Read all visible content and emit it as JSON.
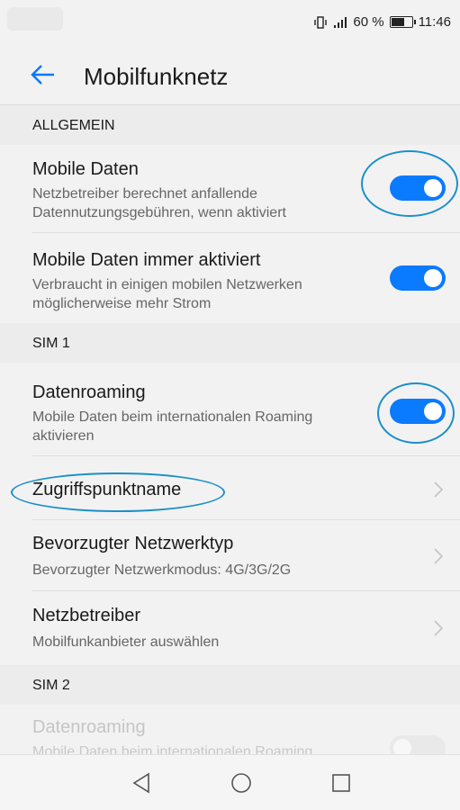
{
  "status": {
    "signal_text": "60 %",
    "time": "11:46"
  },
  "header": {
    "title": "Mobilfunknetz"
  },
  "sections": {
    "general": "ALLGEMEIN",
    "sim1": "SIM 1",
    "sim2": "SIM 2"
  },
  "items": {
    "mobile_data": {
      "title": "Mobile Daten",
      "subtitle": "Netzbetreiber berechnet anfallende Datennutzungsgebühren, wenn aktiviert",
      "enabled": true
    },
    "mobile_data_always": {
      "title": "Mobile Daten immer aktiviert",
      "subtitle": "Verbraucht in einigen mobilen Netzwerken möglicherweise mehr Strom",
      "enabled": true
    },
    "data_roaming_sim1": {
      "title": "Datenroaming",
      "subtitle": "Mobile Daten beim internationalen Roaming aktivieren",
      "enabled": true
    },
    "apn": {
      "title": "Zugriffspunktname"
    },
    "preferred_network": {
      "title": "Bevorzugter Netzwerktyp",
      "subtitle": "Bevorzugter Netzwerkmodus: 4G/3G/2G"
    },
    "operator": {
      "title": "Netzbetreiber",
      "subtitle": "Mobilfunkanbieter auswählen"
    },
    "data_roaming_sim2": {
      "title": "Datenroaming",
      "subtitle": "Mobile Daten beim internationalen Roaming aktivieren",
      "enabled": false
    }
  },
  "icons": {
    "back": "arrow-left-icon",
    "chevron": "chevron-right-icon",
    "nav_back": "triangle-back-icon",
    "nav_home": "circle-home-icon",
    "nav_recents": "square-recents-icon"
  },
  "colors": {
    "accent": "#0a7aff",
    "annotation": "#1c8fc9"
  }
}
